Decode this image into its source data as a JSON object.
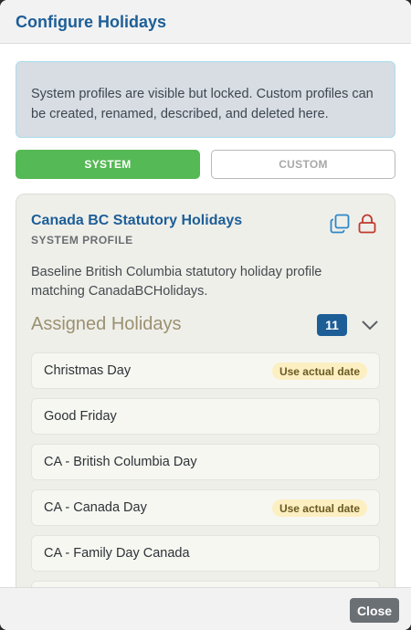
{
  "dialog": {
    "title": "Configure Holidays",
    "info_text": "System profiles are visible but locked. Custom profiles can be created, renamed, described, and deleted here.",
    "tabs": [
      {
        "label": "SYSTEM",
        "active": true
      },
      {
        "label": "CUSTOM",
        "active": false
      }
    ],
    "close_label": "Close"
  },
  "profile": {
    "name": "Canada BC Statutory Holidays",
    "type_label": "SYSTEM PROFILE",
    "description": "Baseline British Columbia statutory holiday profile matching CanadaBCHolidays.",
    "copy_icon": "copy-icon",
    "lock_icon": "lock-icon"
  },
  "assigned": {
    "title": "Assigned Holidays",
    "count": "11",
    "toggle_icon": "chevron-down-icon",
    "items": [
      {
        "name": "Christmas Day",
        "badge": "Use actual date"
      },
      {
        "name": "Good Friday",
        "badge": ""
      },
      {
        "name": "CA - British Columbia Day",
        "badge": ""
      },
      {
        "name": "CA - Canada Day",
        "badge": "Use actual date"
      },
      {
        "name": "CA - Family Day Canada",
        "badge": ""
      },
      {
        "name": "",
        "badge": ""
      }
    ]
  },
  "colors": {
    "accent": "#1d5e97",
    "system_tab": "#55b955",
    "lock": "#c0392b",
    "badge_bg": "#fcefc2"
  }
}
